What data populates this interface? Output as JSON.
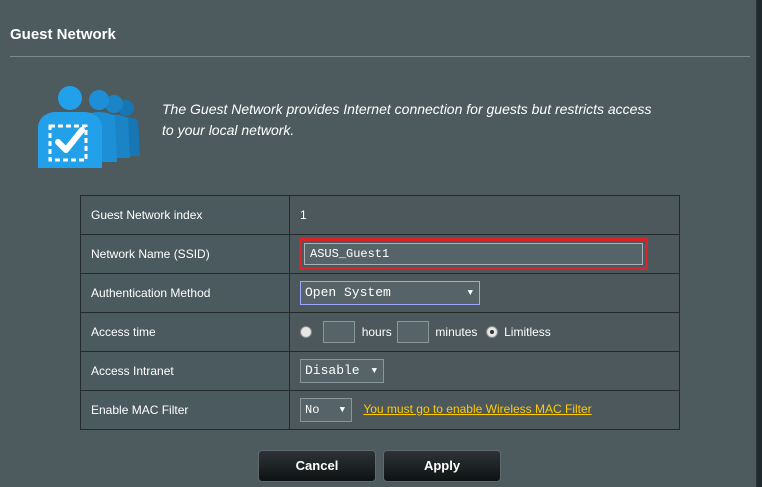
{
  "page": {
    "title": "Guest Network",
    "intro_line1": "The Guest Network provides Internet connection for guests but restricts access",
    "intro_line2": "to your local network."
  },
  "form": {
    "index_label": "Guest Network index",
    "index_value": "1",
    "ssid_label": "Network Name (SSID)",
    "ssid_value": "ASUS_Guest1",
    "auth_label": "Authentication Method",
    "auth_value": "Open System",
    "access_time_label": "Access time",
    "hours_value": "",
    "hours_unit": "hours",
    "minutes_value": "",
    "minutes_unit": "minutes",
    "limitless_label": "Limitless",
    "access_time_selected": "Limitless",
    "intranet_label": "Access Intranet",
    "intranet_value": "Disable",
    "mac_label": "Enable MAC Filter",
    "mac_value": "No",
    "mac_link": "You must go to enable Wireless MAC Filter"
  },
  "buttons": {
    "cancel": "Cancel",
    "apply": "Apply"
  },
  "icons": {
    "logo": "guest-users-icon",
    "select_arrow": "triangle-down-icon"
  },
  "colors": {
    "background": "#4d5a5e",
    "highlight_border": "#d8232a",
    "link": "#ffcc00",
    "logo_blue": "#1d8fd6"
  }
}
